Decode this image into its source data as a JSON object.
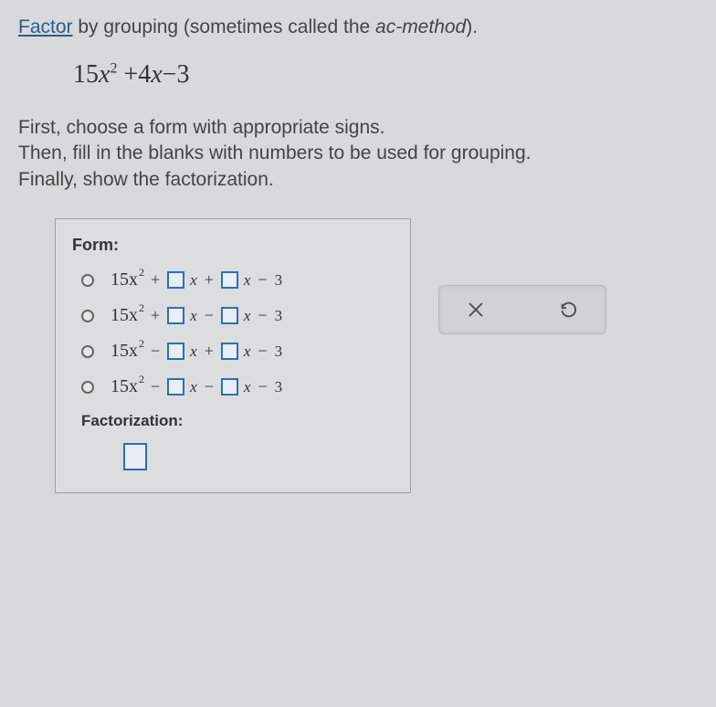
{
  "prompt": {
    "factor_link": "Factor",
    "rest": " by grouping (sometimes called the ",
    "ac_method": "ac-method",
    "end": ")."
  },
  "expression": {
    "lead_coef": "15",
    "var1": "x",
    "exp": "2",
    "op1": "+",
    "mid_coef": "4",
    "var2": "x",
    "op2": "−",
    "const": "3"
  },
  "instructions": {
    "line1": "First, choose a form with appropriate signs.",
    "line2": "Then, fill in the blanks with numbers to be used for grouping.",
    "line3": "Finally, show the factorization."
  },
  "form": {
    "title": "Form:",
    "options": [
      {
        "sign1": "+",
        "sign2": "+"
      },
      {
        "sign1": "+",
        "sign2": "−"
      },
      {
        "sign1": "−",
        "sign2": "+"
      },
      {
        "sign1": "−",
        "sign2": "−"
      }
    ],
    "lead": "15x",
    "exp": "2",
    "var": "x",
    "tail_op": "−",
    "tail_const": "3",
    "factorization_title": "Factorization:"
  },
  "toolbar": {
    "clear_name": "close-icon",
    "undo_name": "undo-icon"
  }
}
